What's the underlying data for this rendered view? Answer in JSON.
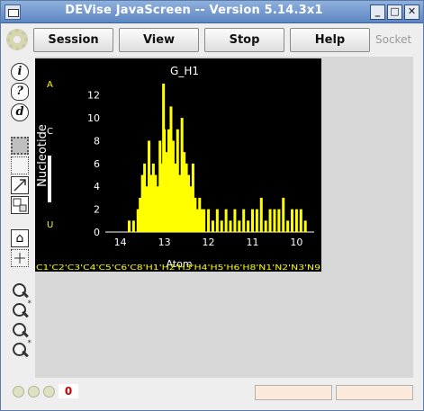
{
  "window": {
    "title": "DEVise JavaScreen -- Version 5.14.3x1",
    "controls": [
      "_",
      "□",
      "✕"
    ]
  },
  "menu": {
    "buttons": [
      "Session",
      "View",
      "Stop",
      "Help"
    ],
    "socket_label": "Socket"
  },
  "tools": {
    "info": "i",
    "help": "?",
    "d": "d"
  },
  "status": {
    "error_count": "0"
  },
  "chart_data": {
    "type": "bar",
    "title": "G_H1",
    "xlabel": "Atom",
    "ylabel": "Nucleotide",
    "xlim": [
      14.3,
      9.6
    ],
    "ylim": [
      0,
      13
    ],
    "x_ticks": [
      14,
      13,
      12,
      11,
      10
    ],
    "y_ticks": [
      0,
      2,
      4,
      6,
      8,
      10,
      12
    ],
    "side_letters": [
      "A",
      "C",
      "U"
    ],
    "color": "#ffff00",
    "x": [
      13.8,
      13.7,
      13.6,
      13.55,
      13.5,
      13.45,
      13.4,
      13.35,
      13.3,
      13.25,
      13.2,
      13.15,
      13.1,
      13.05,
      13.02,
      13.0,
      12.95,
      12.9,
      12.85,
      12.8,
      12.75,
      12.7,
      12.65,
      12.6,
      12.55,
      12.5,
      12.45,
      12.4,
      12.35,
      12.3,
      12.25,
      12.2,
      12.15,
      12.1,
      12.0,
      11.9,
      11.8,
      11.7,
      11.6,
      11.5,
      11.4,
      11.3,
      11.2,
      11.1,
      11.0,
      10.9,
      10.8,
      10.7,
      10.6,
      10.5,
      10.4,
      10.3,
      10.2,
      10.1,
      10.0,
      9.9,
      9.8
    ],
    "y": [
      1,
      1,
      2,
      3,
      5,
      6,
      4,
      8,
      5,
      6,
      5,
      4,
      8,
      6,
      13,
      9,
      7,
      9,
      11,
      8,
      6,
      9,
      5,
      10,
      7,
      6,
      5,
      4,
      6,
      3,
      2,
      3,
      2,
      2,
      2,
      1,
      2,
      1,
      2,
      1,
      2,
      1,
      2,
      1,
      2,
      2,
      3,
      1,
      2,
      2,
      2,
      3,
      1,
      2,
      2,
      2,
      1
    ],
    "atom_strip": "C1'C2'C3'C4'C5'C6'C8'H1'H2'H3'H4'H5'H6'H8'N1'N2'N3'N9"
  }
}
